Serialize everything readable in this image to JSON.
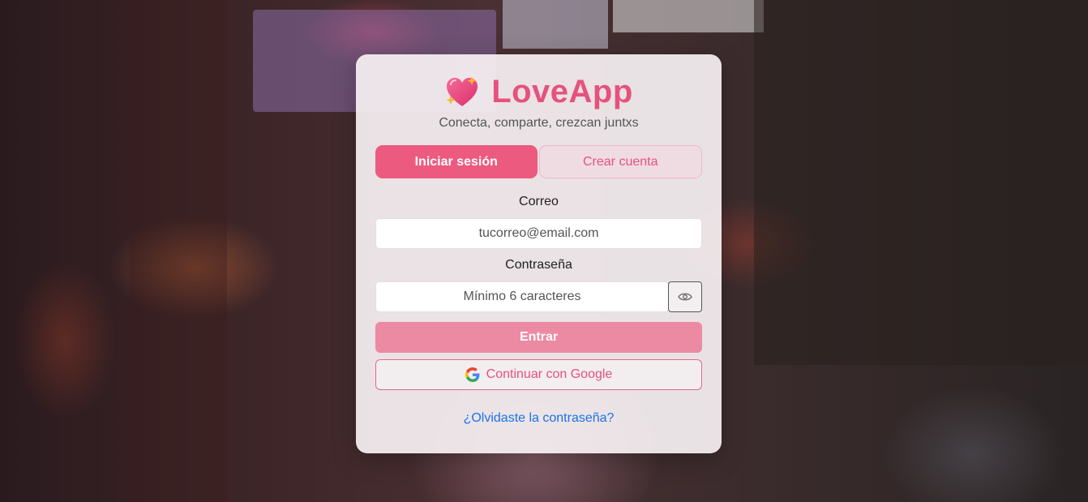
{
  "brand": {
    "name": "LoveApp",
    "tagline": "Conecta, comparte, crezcan juntxs",
    "icon": "sparkling-heart-icon",
    "color": "#e5527e"
  },
  "tabs": [
    {
      "label": "Iniciar sesión",
      "active": true
    },
    {
      "label": "Crear cuenta",
      "active": false
    }
  ],
  "form": {
    "email_label": "Correo",
    "email_placeholder": "tucorreo@email.com",
    "password_label": "Contraseña",
    "password_placeholder": "Mínimo 6 caracteres",
    "toggle_icon": "eye-icon",
    "submit_label": "Entrar",
    "google_label": "Continuar con Google",
    "forgot_label": "¿Olvidaste la contraseña?"
  },
  "colors": {
    "accent": "#ec5a80",
    "submit_disabled": "#ec8aa3",
    "link": "#1a73e8"
  }
}
